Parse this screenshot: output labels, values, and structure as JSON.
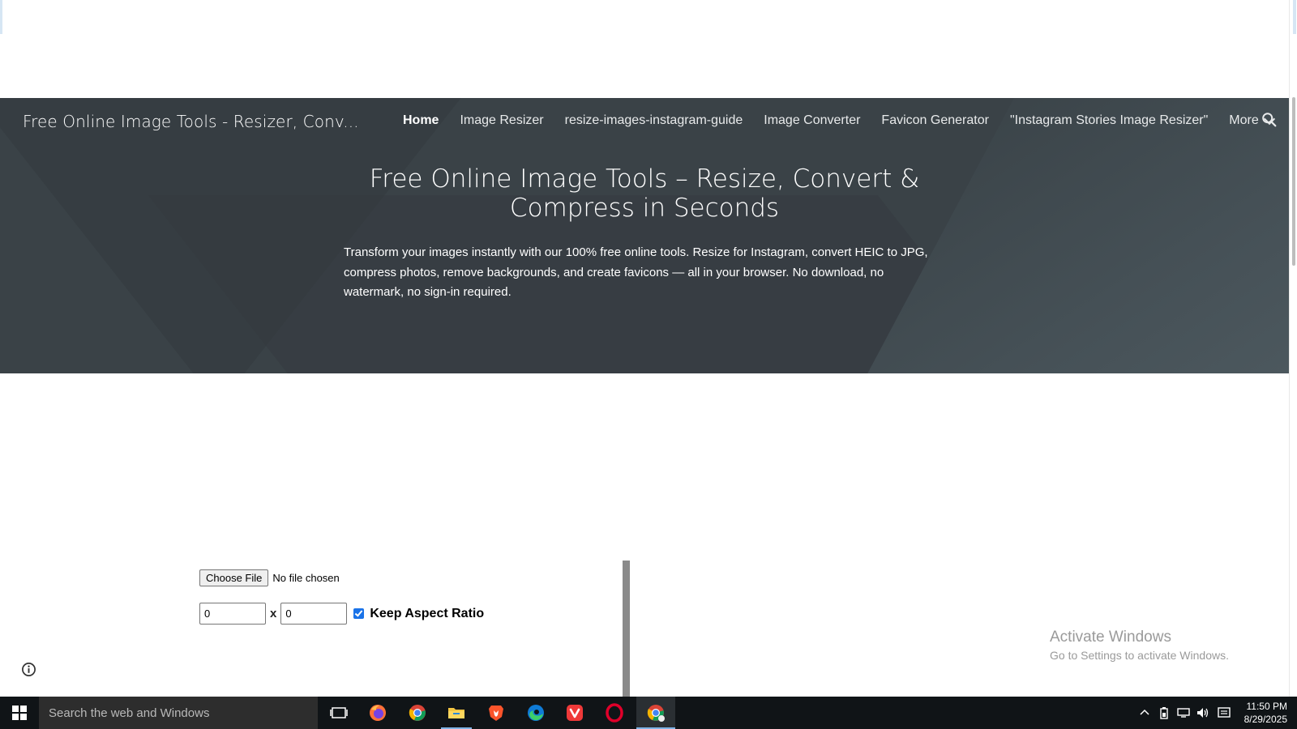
{
  "site": {
    "title": "Free Online Image Tools - Resizer, Conv..."
  },
  "nav": {
    "items": [
      "Home",
      "Image Resizer",
      "resize-images-instagram-guide",
      "Image Converter",
      "Favicon Generator",
      "\"Instagram Stories Image Resizer\""
    ],
    "more_label": "More",
    "active": "Home"
  },
  "hero": {
    "heading": "Free Online Image Tools – Resize, Convert & Compress in Seconds",
    "text": "Transform your images instantly with our 100% free online tools. Resize for Instagram, convert HEIC to JPG, compress photos, remove backgrounds, and create favicons — all in your browser. No download, no watermark, no sign-in required."
  },
  "tool": {
    "choose_file_label": "Choose File",
    "file_status": "No file chosen",
    "width_value": "0",
    "height_value": "0",
    "separator": "x",
    "keep_aspect_label": "Keep Aspect Ratio",
    "keep_aspect_checked": true
  },
  "watermark": {
    "line1": "Activate Windows",
    "line2": "Go to Settings to activate Windows."
  },
  "taskbar": {
    "search_placeholder": "Search the web and Windows",
    "apps": [
      "task-view",
      "firefox",
      "chrome",
      "file-explorer",
      "brave",
      "edge",
      "vivaldi",
      "opera",
      "chrome-profile"
    ],
    "active_apps": [
      "file-explorer",
      "chrome-profile"
    ],
    "time": "11:50 PM",
    "date": "8/29/2025"
  },
  "colors": {
    "hero_bg": "#3a4247",
    "taskbar_bg": "#101417",
    "checkbox": "#1a73e8"
  }
}
